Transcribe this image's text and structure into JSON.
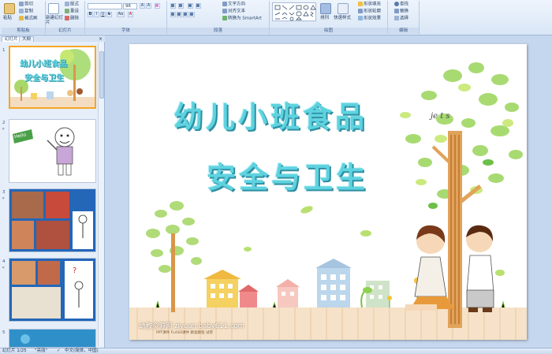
{
  "ribbon": {
    "clipboard": {
      "label": "剪贴板",
      "paste": "粘贴",
      "cut": "剪切",
      "copy": "复制",
      "format_painter": "格式刷"
    },
    "slides": {
      "label": "幻灯片",
      "new_slide": "新建幻灯片",
      "layout": "版式",
      "reset": "重设",
      "delete": "删除"
    },
    "font": {
      "label": "字体",
      "font_name": "",
      "font_size": "96",
      "buttons": [
        "A",
        "A",
        "B",
        "I",
        "U",
        "S",
        "Aa",
        "A"
      ]
    },
    "paragraph": {
      "label": "段落",
      "text_direction": "文字方向",
      "align_text": "对齐文本",
      "smartart": "转换为 SmartArt"
    },
    "drawing": {
      "label": "绘图",
      "arrange": "排列",
      "quick_styles": "快速样式",
      "shape_fill": "形状填充",
      "shape_outline": "形状轮廓",
      "shape_effects": "形状效果"
    },
    "editing": {
      "label": "编辑",
      "find": "查找",
      "replace": "替换",
      "select": "选择"
    }
  },
  "panel": {
    "tabs": [
      "幻灯片",
      "大纲"
    ],
    "close": "×",
    "slides": [
      {
        "number": "1",
        "title_lines": [
          "幼儿小班食品",
          "安全与卫生"
        ]
      },
      {
        "number": "2",
        "text": "Hello"
      },
      {
        "number": "3"
      },
      {
        "number": "4"
      },
      {
        "number": "5"
      }
    ]
  },
  "slide": {
    "title_line1": "幼儿小班食品",
    "title_line2": "安全与卫生",
    "watermark": "幼教资源网 ziyuan.baby611.com",
    "watermark_sub": "PPT课件 FLASH课件 教案教程 试卷",
    "deco_script": "je  t  s"
  },
  "status": {
    "slide_counter": "幻灯片 1/25",
    "theme": "\"亮丽\"",
    "language": "中文(简体，中国)"
  },
  "colors": {
    "title": "#5ed3df",
    "title_shadow": "#2f8fa3",
    "selection": "#f5a623",
    "leaf_green": "#8fd14f",
    "trunk": "#e0a35a"
  }
}
